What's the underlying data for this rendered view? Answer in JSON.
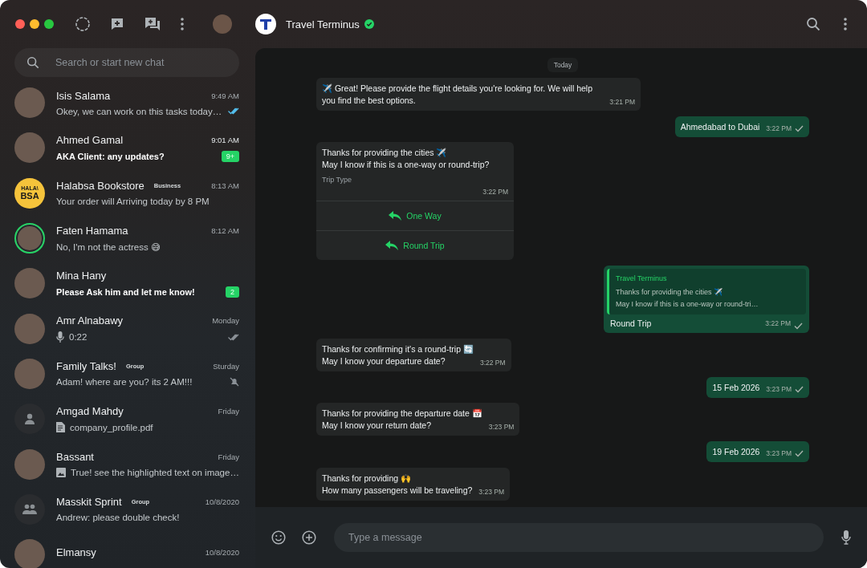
{
  "header": {
    "contact": {
      "name": "Travel Terminus",
      "verified": true
    }
  },
  "search": {
    "placeholder": "Search or start new chat"
  },
  "chats": [
    {
      "name": "Isis Salama",
      "time": "9:49 AM",
      "preview": "Okey, we can work on this tasks today…",
      "avatar": {
        "kind": "photo"
      },
      "story": false,
      "unread": false,
      "indicator": {
        "kind": "read"
      }
    },
    {
      "name": "Ahmed Gamal",
      "time": "9:01 AM",
      "preview": "AKA Client: any updates?",
      "avatar": {
        "kind": "photo"
      },
      "story": false,
      "unread": true,
      "badge": "9+"
    },
    {
      "name": "Halabsa Bookstore",
      "tag": "Business",
      "time": "8:13 AM",
      "preview": "Your order will Arriving today by 8 PM",
      "avatar": {
        "kind": "logo",
        "lines": [
          "HALA\\",
          "BSA"
        ]
      },
      "story": false,
      "unread": false
    },
    {
      "name": "Faten Hamama",
      "time": "8:12 AM",
      "preview": "No, I'm not the actress 😅",
      "avatar": {
        "kind": "photo"
      },
      "story": true,
      "unread": false
    },
    {
      "name": "Mina Hany",
      "preview": "Please Ask him and let me know!",
      "avatar": {
        "kind": "photo"
      },
      "story": false,
      "unread": true,
      "badge": "2"
    },
    {
      "name": "Amr Alnabawy",
      "time": "Monday",
      "preview": "0:22",
      "attachment": {
        "kind": "voice"
      },
      "avatar": {
        "kind": "photo"
      },
      "story": false,
      "unread": false,
      "indicator": {
        "kind": "delivered"
      }
    },
    {
      "name": "Family Talks!",
      "tag": "Group",
      "time": "Sturday",
      "preview": "Adam! where are you? its 2 AM!!!",
      "avatar": {
        "kind": "photo"
      },
      "story": false,
      "unread": false,
      "indicator": {
        "kind": "muted"
      }
    },
    {
      "name": "Amgad Mahdy",
      "time": "Friday",
      "preview": "company_profile.pdf",
      "attachment": {
        "kind": "document"
      },
      "avatar": {
        "kind": "person"
      },
      "story": false,
      "unread": false
    },
    {
      "name": "Bassant",
      "time": "Friday",
      "preview": "True! see the highlighted text on image…",
      "attachment": {
        "kind": "image"
      },
      "avatar": {
        "kind": "photo"
      },
      "story": false,
      "unread": false
    },
    {
      "name": "Masskit Sprint",
      "tag": "Group",
      "time": "10/8/2020",
      "preview": "Andrew: please double check!",
      "avatar": {
        "kind": "group"
      },
      "story": false,
      "unread": false
    },
    {
      "name": "Elmansy",
      "time": "10/8/2020",
      "avatar": {
        "kind": "photo"
      },
      "story": false
    }
  ],
  "messages": [
    {
      "kind": "date",
      "text": "Today"
    },
    {
      "kind": "in",
      "text": "✈️ Great! Please provide the flight details you're looking for. We will help you find the best options.",
      "time": "3:21 PM"
    },
    {
      "kind": "out",
      "text": "Ahmedabad to Dubai",
      "time": "3:22 PM",
      "receipt": {
        "kind": "sent"
      }
    },
    {
      "kind": "buttons",
      "text": "Thanks for providing the cities ✈️\nMay I know if this is a one-way or round-trip?",
      "footer": "Trip Type",
      "time": "3:22 PM",
      "buttons": [
        "One Way",
        "Round Trip"
      ]
    },
    {
      "kind": "reply",
      "quote": {
        "author": "Travel Terminus",
        "text": "Thanks for providing the cities ✈️\nMay I know if this is a one-way or round-tri…"
      },
      "text": "Round Trip",
      "time": "3:22 PM",
      "receipt": {
        "kind": "sent"
      }
    },
    {
      "kind": "in",
      "text": "Thanks for confirming it's a round-trip 🔄\nMay I know your departure date?",
      "time": "3:22 PM"
    },
    {
      "kind": "out",
      "text": "15 Feb 2026",
      "time": "3:23 PM",
      "receipt": {
        "kind": "sent"
      }
    },
    {
      "kind": "in",
      "text": "Thanks for providing the departure date 📅\nMay I know your return date?",
      "time": "3:23 PM"
    },
    {
      "kind": "out",
      "text": "19 Feb 2026",
      "time": "3:23 PM",
      "receipt": {
        "kind": "sent"
      }
    },
    {
      "kind": "in",
      "text": "Thanks for providing 🙌\nHow many passengers will be traveling?",
      "time": "3:23 PM"
    }
  ],
  "composer": {
    "placeholder": "Type a message"
  }
}
